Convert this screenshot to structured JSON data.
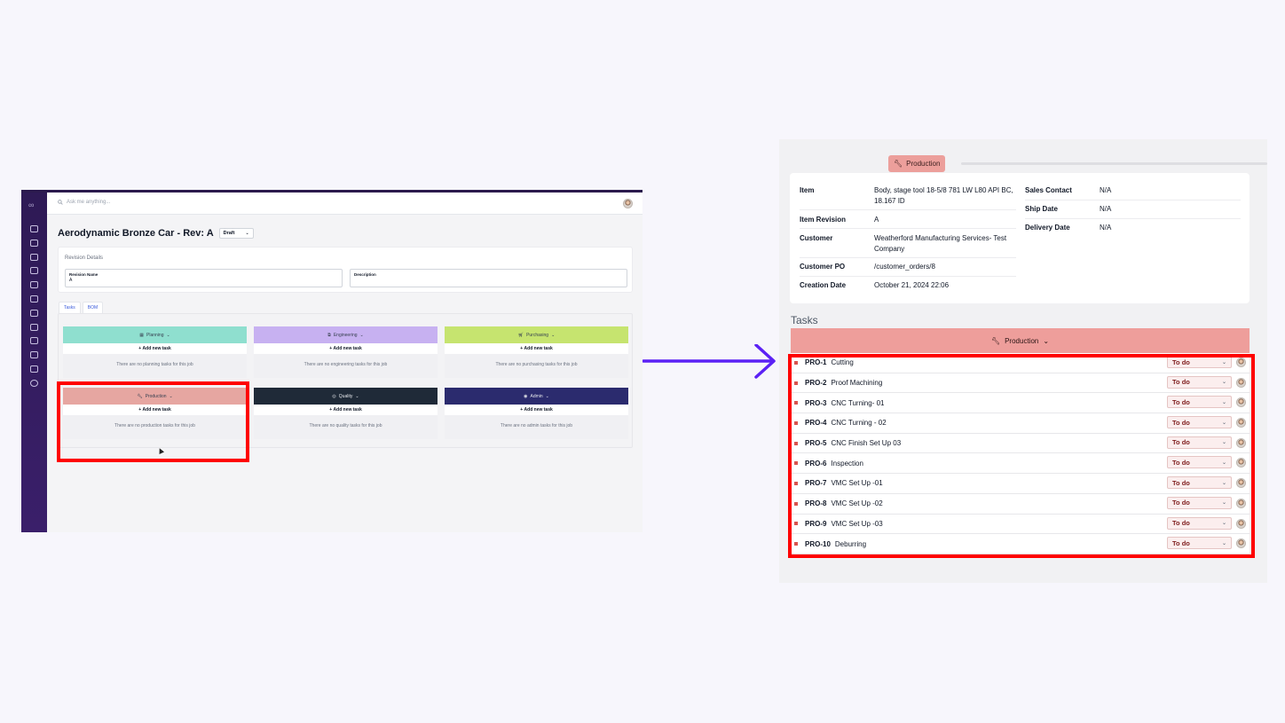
{
  "left": {
    "search_placeholder": "Ask me anything...",
    "title": "Aerodynamic Bronze Car - Rev: A",
    "status": "Draft",
    "revision_details_header": "Revision Details",
    "revision_name_label": "Revision Name",
    "revision_name_value": "A",
    "description_label": "Description",
    "tabs": [
      "Tasks",
      "BOM"
    ],
    "columns": [
      {
        "name": "Planning",
        "color": "#8fdfcf",
        "icon": "calendar-icon",
        "add_label": "Add new task",
        "empty": "There are no planning tasks for this job"
      },
      {
        "name": "Engineering",
        "color": "#c7b1f1",
        "icon": "cube-icon",
        "add_label": "Add new task",
        "empty": "There are no engineering tasks for this job"
      },
      {
        "name": "Purchasing",
        "color": "#c6e46f",
        "icon": "cart-icon",
        "add_label": "Add new task",
        "empty": "There are no purchasing tasks for this job"
      },
      {
        "name": "Production",
        "color": "#e6a6a1",
        "icon": "wrench-icon",
        "add_label": "Add new task",
        "empty": "There are no production tasks for this job"
      },
      {
        "name": "Quality",
        "color": "#1f2a38",
        "icon": "check-circle-icon",
        "add_label": "Add new task",
        "empty": "There are no quality tasks for this job"
      },
      {
        "name": "Admin",
        "color": "#2b2b6e",
        "icon": "user-circle-icon",
        "add_label": "Add new task",
        "empty": "There are no admin tasks for this job"
      }
    ]
  },
  "right": {
    "production_chip": "Production",
    "details_left": [
      {
        "key": "Item",
        "value": "Body, stage tool 18-5/8 781 LW L80 API BC, 18.167 ID"
      },
      {
        "key": "Item Revision",
        "value": "A"
      },
      {
        "key": "Customer",
        "value": "Weatherford Manufacturing Services- Test Company"
      },
      {
        "key": "Customer PO",
        "value": "/customer_orders/8"
      },
      {
        "key": "Creation Date",
        "value": "October 21, 2024 22:06"
      }
    ],
    "details_right": [
      {
        "key": "Sales Contact",
        "value": "N/A"
      },
      {
        "key": "Ship Date",
        "value": "N/A"
      },
      {
        "key": "Delivery Date",
        "value": "N/A"
      }
    ],
    "tasks_title": "Tasks",
    "tasks_group": "Production",
    "tasks": [
      {
        "code": "PRO-1",
        "name": "Cutting",
        "status": "To do"
      },
      {
        "code": "PRO-2",
        "name": "Proof Machining",
        "status": "To do"
      },
      {
        "code": "PRO-3",
        "name": "CNC Turning- 01",
        "status": "To do"
      },
      {
        "code": "PRO-4",
        "name": "CNC Turning - 02",
        "status": "To do"
      },
      {
        "code": "PRO-5",
        "name": "CNC Finish Set Up 03",
        "status": "To do"
      },
      {
        "code": "PRO-6",
        "name": "Inspection",
        "status": "To do"
      },
      {
        "code": "PRO-7",
        "name": "VMC Set Up -01",
        "status": "To do"
      },
      {
        "code": "PRO-8",
        "name": "VMC Set Up -02",
        "status": "To do"
      },
      {
        "code": "PRO-9",
        "name": "VMC Set Up -03",
        "status": "To do"
      },
      {
        "code": "PRO-10",
        "name": "Deburring",
        "status": "To do"
      }
    ]
  },
  "colors": {
    "highlight": "#ff0000",
    "arrow": "#5b21f5"
  }
}
